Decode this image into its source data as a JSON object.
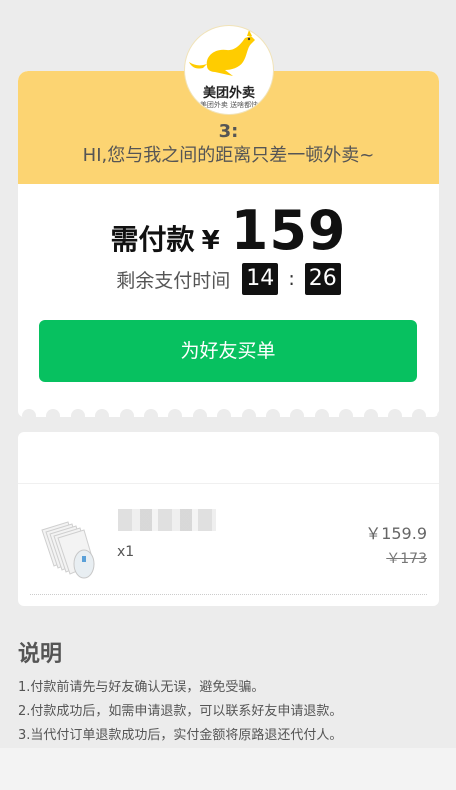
{
  "header": {
    "logo_text": "美团外卖",
    "logo_sub": "美团外卖 送啥都快",
    "sender": "3:",
    "slogan": "HI,您与我之间的距离只差一顿外卖~"
  },
  "payment": {
    "label": "需付款",
    "currency": "¥",
    "amount": "159",
    "timer_label": "剩余支付时间",
    "minutes": "14",
    "colon": ":",
    "seconds": "26",
    "button_label": "为好友买单"
  },
  "order": {
    "items": [
      {
        "qty": "x1",
        "price": "￥159.9",
        "original_price": "￥173"
      }
    ]
  },
  "notes": {
    "title": "说明",
    "lines": [
      "1.付款前请先与好友确认无误，避免受骗。",
      "2.付款成功后，如需申请退款，可以联系好友申请退款。",
      "3.当代付订单退款成功后，实付金额将原路退还代付人。"
    ]
  },
  "colors": {
    "header_bg": "#fcd472",
    "button_bg": "#07c160",
    "page_bg": "#ececec"
  }
}
